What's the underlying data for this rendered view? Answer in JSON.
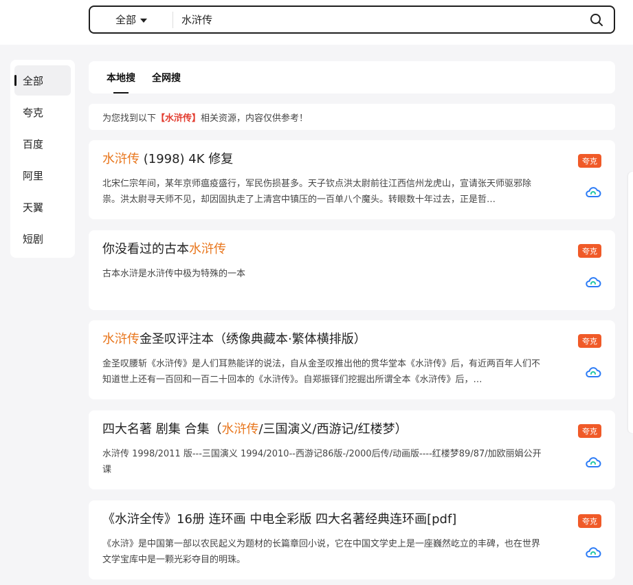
{
  "search": {
    "scope": "全部",
    "query": "水浒传"
  },
  "sidebar": {
    "items": [
      {
        "label": "全部"
      },
      {
        "label": "夸克"
      },
      {
        "label": "百度"
      },
      {
        "label": "阿里"
      },
      {
        "label": "天翼"
      },
      {
        "label": "短剧"
      }
    ]
  },
  "tabs": [
    {
      "label": "本地搜"
    },
    {
      "label": "全网搜"
    }
  ],
  "notice": {
    "prefix": "为您找到以下",
    "highlight": "【水浒传】",
    "suffix": "相关资源，内容仅供参考！"
  },
  "results": [
    {
      "title_before": "",
      "title_kw": "水浒传",
      "title_after": " (1998) 4K 修复",
      "desc": "北宋仁宗年间，某年京师瘟疫盛行，军民伤损甚多。天子钦点洪太尉前往江西信州龙虎山，宣请张天师驱邪除祟。洪太尉寻天师不见，却因固执走了上清宫中镇压的一百单八个魔头。转眼数十年过去，正是哲…",
      "badge": "夸克",
      "icon": "cloud-icon"
    },
    {
      "title_before": "你没看过的古本",
      "title_kw": "水浒传",
      "title_after": "",
      "desc": "古本水浒是水浒传中极为特殊的一本",
      "badge": "夸克",
      "icon": "cloud-icon"
    },
    {
      "title_before": "",
      "title_kw": "水浒传",
      "title_after": "金圣叹评注本（绣像典藏本·繁体横排版）",
      "desc": "金圣叹腰斩《水浒传》是人们耳熟能详的说法，自从金圣叹推出他的贯华堂本《水浒传》后，有近两百年人们不知道世上还有一百回和一百二十回本的《水浒传》。自郑振铎们挖掘出所谓全本《水浒传》后，…",
      "badge": "夸克",
      "icon": "cloud-icon"
    },
    {
      "title_before": "四大名著 剧集 合集（",
      "title_kw": "水浒传",
      "title_after": "/三国演义/西游记/红楼梦）",
      "desc": "水浒传 1998/2011 版---三国演义 1994/2010--西游记86版-/2000后传/动画版----红楼梦89/87/加欧丽娟公开课",
      "badge": "夸克",
      "icon": "cloud-icon"
    },
    {
      "title_before": "《水浒全传》16册 连环画 中电全彩版 四大名著经典连环画[pdf]",
      "title_kw": "",
      "title_after": "",
      "desc": "《水浒》是中国第一部以农民起义为题材的长篇章回小说，它在中国文学史上是一座巍然屹立的丰碑，也在世界文学宝库中是一颗光彩夺目的明珠。",
      "badge": "夸克",
      "icon": "cloud-icon"
    }
  ]
}
